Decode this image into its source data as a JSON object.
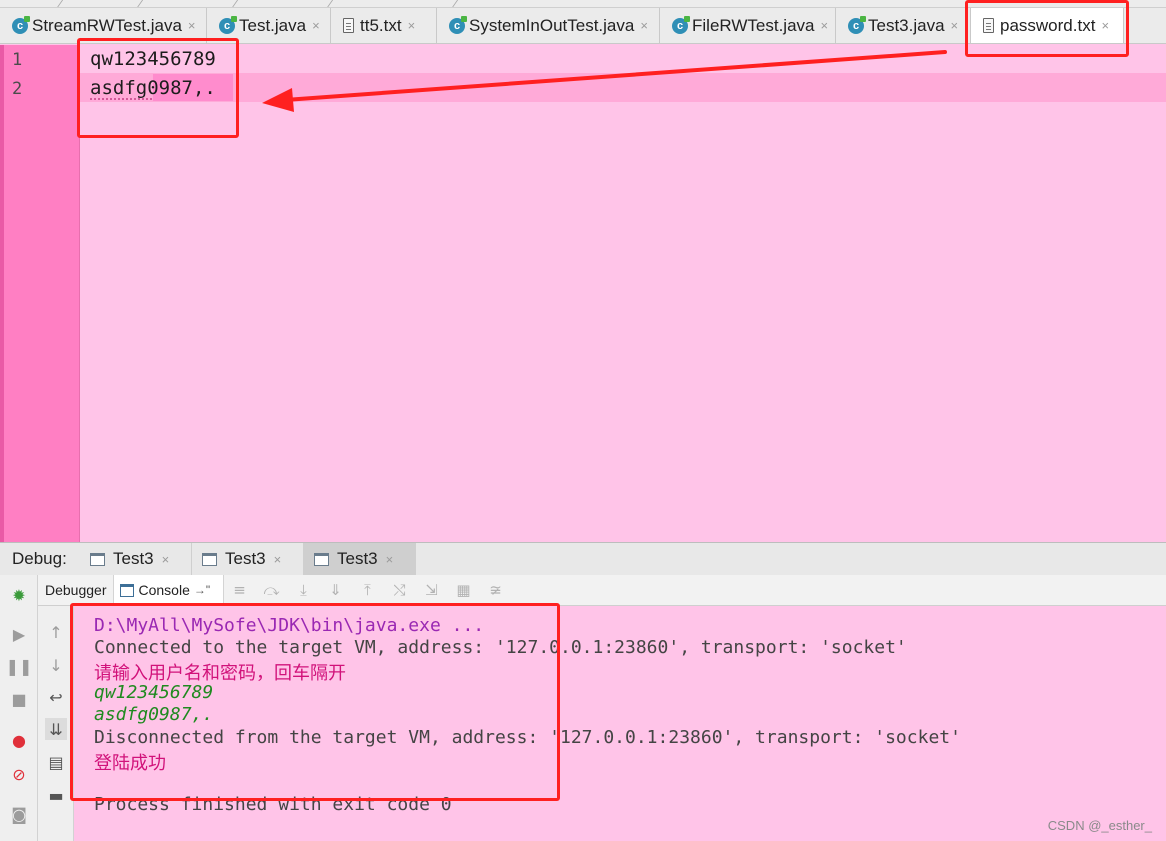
{
  "editor_tabs": [
    {
      "label": "StreamRWTest.java",
      "type": "class",
      "active": false
    },
    {
      "label": "Test.java",
      "type": "class",
      "active": false
    },
    {
      "label": "tt5.txt",
      "type": "text",
      "active": false
    },
    {
      "label": "SystemInOutTest.java",
      "type": "class",
      "active": false
    },
    {
      "label": "FileRWTest.java",
      "type": "class",
      "active": false
    },
    {
      "label": "Test3.java",
      "type": "class",
      "active": false
    },
    {
      "label": "password.txt",
      "type": "text",
      "active": true
    }
  ],
  "tab_close_glyph": "×",
  "editor": {
    "lines": [
      {
        "no": "1",
        "text": "qw123456789"
      },
      {
        "no": "2",
        "text": "asdfg0987,."
      }
    ]
  },
  "debug": {
    "label": "Debug:",
    "sessions": [
      "Test3",
      "Test3",
      "Test3"
    ],
    "subtabs": {
      "debugger": "Debugger",
      "console": "Console"
    }
  },
  "console": {
    "lines": [
      {
        "kind": "cmd",
        "text": "D:\\MyAll\\MySofe\\JDK\\bin\\java.exe ..."
      },
      {
        "kind": "sys",
        "text": "Connected to the target VM, address: '127.0.0.1:23860', transport: 'socket'"
      },
      {
        "kind": "prompt",
        "text": "请输入用户名和密码，回车隔开"
      },
      {
        "kind": "input",
        "text": "qw123456789"
      },
      {
        "kind": "input",
        "text": "asdfg0987,."
      },
      {
        "kind": "sys",
        "text": "Disconnected from the target VM, address: '127.0.0.1:23860', transport: 'socket'"
      },
      {
        "kind": "prompt",
        "text": "登陆成功"
      },
      {
        "kind": "blank",
        "text": ""
      },
      {
        "kind": "sys",
        "text": "Process finished with exit code 0"
      }
    ]
  },
  "watermark": "CSDN @_esther_",
  "colors": {
    "editor_bg": "#ffc4e8",
    "gutter_bg": "#ff7fc3",
    "annotation_red": "#ff2020"
  }
}
